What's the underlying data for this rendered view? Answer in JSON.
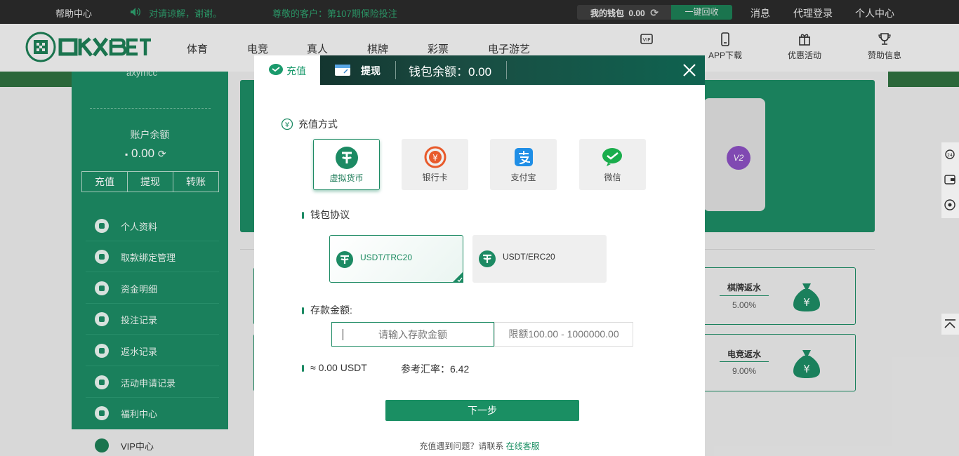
{
  "topbar": {
    "help": "帮助中心",
    "notice": "对请谅解，谢谢。",
    "notice2": "尊敬的客户：第107期保险投注",
    "wallet_label": "我的钱包",
    "wallet_amount": "0.00",
    "recycle": "一键回收",
    "messages": "消息",
    "agent_login": "代理登录",
    "personal_center": "个人中心"
  },
  "header": {
    "logo_text": "OKXBET",
    "nav": [
      "体育",
      "电竞",
      "真人",
      "棋牌",
      "彩票",
      "电子游艺"
    ],
    "icon_links": [
      "APP下载",
      "优惠活动",
      "赞助信息"
    ],
    "vip_label": "VIP"
  },
  "sidebar": {
    "username": "axymcc",
    "balance_label": "账户余额",
    "balance_value": "0.00",
    "buttons": [
      "充值",
      "提现",
      "转账"
    ],
    "menu": [
      "个人资料",
      "取款绑定管理",
      "资金明细",
      "投注记录",
      "返水记录",
      "活动申请记录",
      "福利中心"
    ],
    "vip": "VIP中心"
  },
  "background": {
    "v2": "V2",
    "rebates": [
      {
        "title": "棋牌返水",
        "pct": "5.00%"
      },
      {
        "title": "电竞返水",
        "pct": "9.00%"
      }
    ]
  },
  "modal": {
    "tab_deposit": "充值",
    "tab_withdraw": "提现",
    "wallet_balance": "钱包余额：0.00",
    "method_label": "充值方式",
    "methods": [
      "虚拟货币",
      "银行卡",
      "支付宝",
      "微信"
    ],
    "protocol_label": "钱包协议",
    "protocols": [
      "USDT/TRC20",
      "USDT/ERC20"
    ],
    "amount_label": "存款金额:",
    "amount_placeholder": "请输入存款金额",
    "limit": "限额100.00 - 1000000.00",
    "usdt_estimate": "≈ 0.00 USDT",
    "rate": "参考汇率：6.42",
    "next": "下一步",
    "help_text": "充值遇到问题？请联系",
    "help_link": "在线客服"
  },
  "colors": {
    "accent": "#1c8a63",
    "dark_header": "#2b2b2b"
  }
}
